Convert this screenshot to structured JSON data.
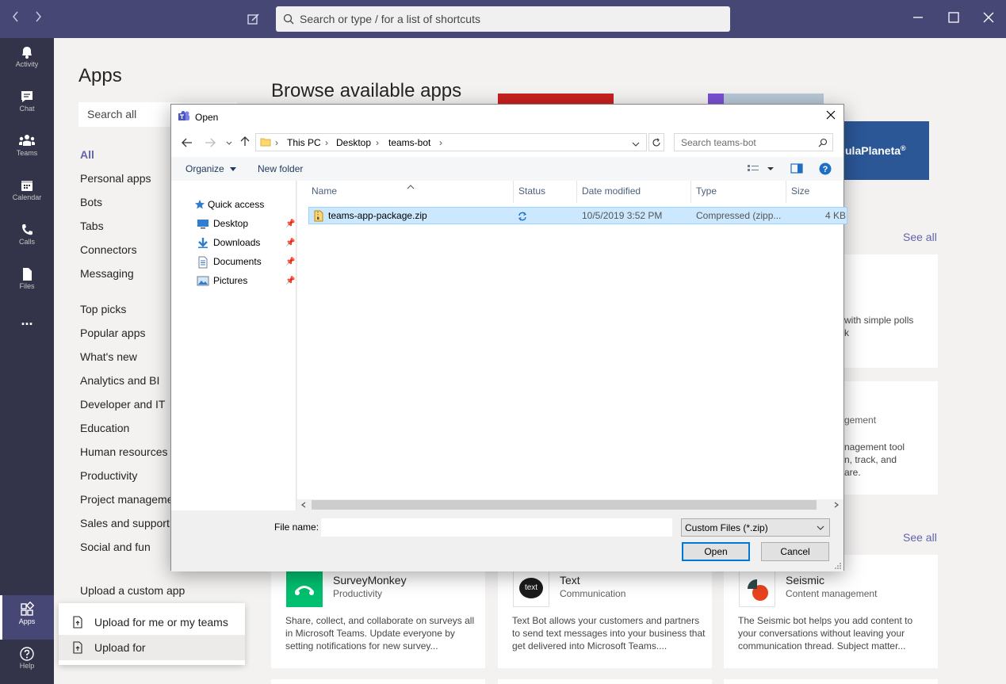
{
  "titlebar": {
    "search_placeholder": "Search or type / for a list of shortcuts"
  },
  "rail": {
    "items": [
      {
        "label": "Activity",
        "icon": "bell-icon"
      },
      {
        "label": "Chat",
        "icon": "chat-icon"
      },
      {
        "label": "Teams",
        "icon": "teams-icon"
      },
      {
        "label": "Calendar",
        "icon": "calendar-icon"
      },
      {
        "label": "Calls",
        "icon": "phone-icon"
      },
      {
        "label": "Files",
        "icon": "file-icon"
      },
      {
        "label": "Apps",
        "icon": "apps-icon"
      },
      {
        "label": "Help",
        "icon": "help-icon"
      }
    ],
    "more": "..."
  },
  "left": {
    "title": "Apps",
    "search_placeholder": "Search all",
    "categories": [
      "All",
      "Personal apps",
      "Bots",
      "Tabs",
      "Connectors",
      "Messaging"
    ],
    "categories2": [
      "Top picks",
      "Popular apps",
      "What's new",
      "Analytics and BI",
      "Developer and IT",
      "Education",
      "Human resources",
      "Productivity",
      "Project management",
      "Sales and support",
      "Social and fun"
    ],
    "upload_custom": "Upload a custom app"
  },
  "upload_popup": {
    "items": [
      "Upload for me or my teams",
      "Upload for"
    ]
  },
  "main": {
    "title": "Browse available apps",
    "banner_text": "ulaPlaneta",
    "see_all": "See all",
    "partial_texts": [
      "with simple polls",
      "k",
      "gement",
      "nagement tool",
      "n, track, and",
      "are."
    ],
    "cards": [
      {
        "name": "SurveyMonkey",
        "category": "Productivity",
        "desc": "Share, collect, and collaborate on surveys all in Microsoft Teams. Update everyone by setting notifications for new survey...",
        "color": "#00bf6f"
      },
      {
        "name": "Text",
        "category": "Communication",
        "desc": "Text Bot allows your customers and partners to send text messages into your business that get delivered into Microsoft Teams....",
        "color": "#1b1b1b"
      },
      {
        "name": "Seismic",
        "category": "Content management",
        "desc": "The Seismic bot helps you add content to your conversations without leaving your communication thread. Subject matter...",
        "color": "#e8431e"
      }
    ],
    "text_logo": "text"
  },
  "dialog": {
    "title": "Open",
    "path": [
      "This PC",
      "Desktop",
      "teams-bot"
    ],
    "search_placeholder": "Search teams-bot",
    "toolbar": {
      "organize": "Organize",
      "new_folder": "New folder"
    },
    "nav": {
      "quick_access": "Quick access",
      "items": [
        "Desktop",
        "Downloads",
        "Documents",
        "Pictures"
      ]
    },
    "columns": [
      "Name",
      "Status",
      "Date modified",
      "Type",
      "Size"
    ],
    "files": [
      {
        "name": "teams-app-package.zip",
        "date": "10/5/2019 3:52 PM",
        "type": "Compressed (zipp...",
        "size": "4 KB"
      }
    ],
    "file_name_label": "File name:",
    "file_name_value": "",
    "file_type": "Custom Files (*.zip)",
    "open_label": "Open",
    "cancel_label": "Cancel"
  },
  "colors": {
    "accent": "#6264a7",
    "titlebar": "#464775",
    "rail": "#33344a",
    "selection": "#cce8ff"
  }
}
